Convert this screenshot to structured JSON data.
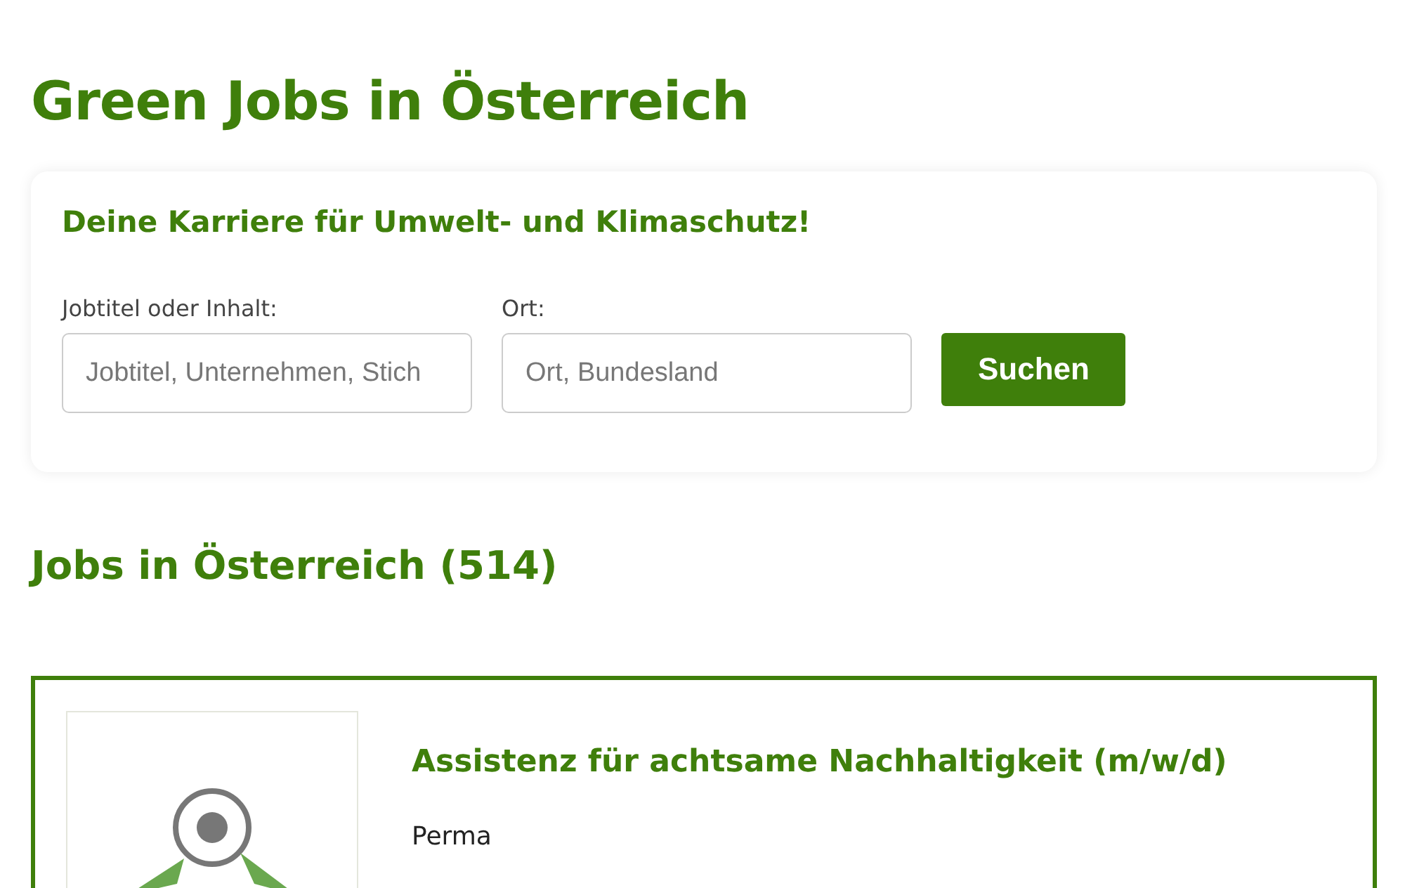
{
  "page_title": "Green Jobs in Österreich",
  "search": {
    "heading": "Deine Karriere für Umwelt- und Klimaschutz!",
    "fields": [
      {
        "label": "Jobtitel oder Inhalt:",
        "placeholder": "Jobtitel, Unternehmen, Stich"
      },
      {
        "label": "Ort:",
        "placeholder": "Ort, Bundesland"
      }
    ],
    "button": "Suchen"
  },
  "results_heading": "Jobs in Österreich (514)",
  "jobs": [
    {
      "title": "Assistenz für achtsame Nachhaltigkeit (m/w/d)",
      "company": "Perma"
    }
  ]
}
